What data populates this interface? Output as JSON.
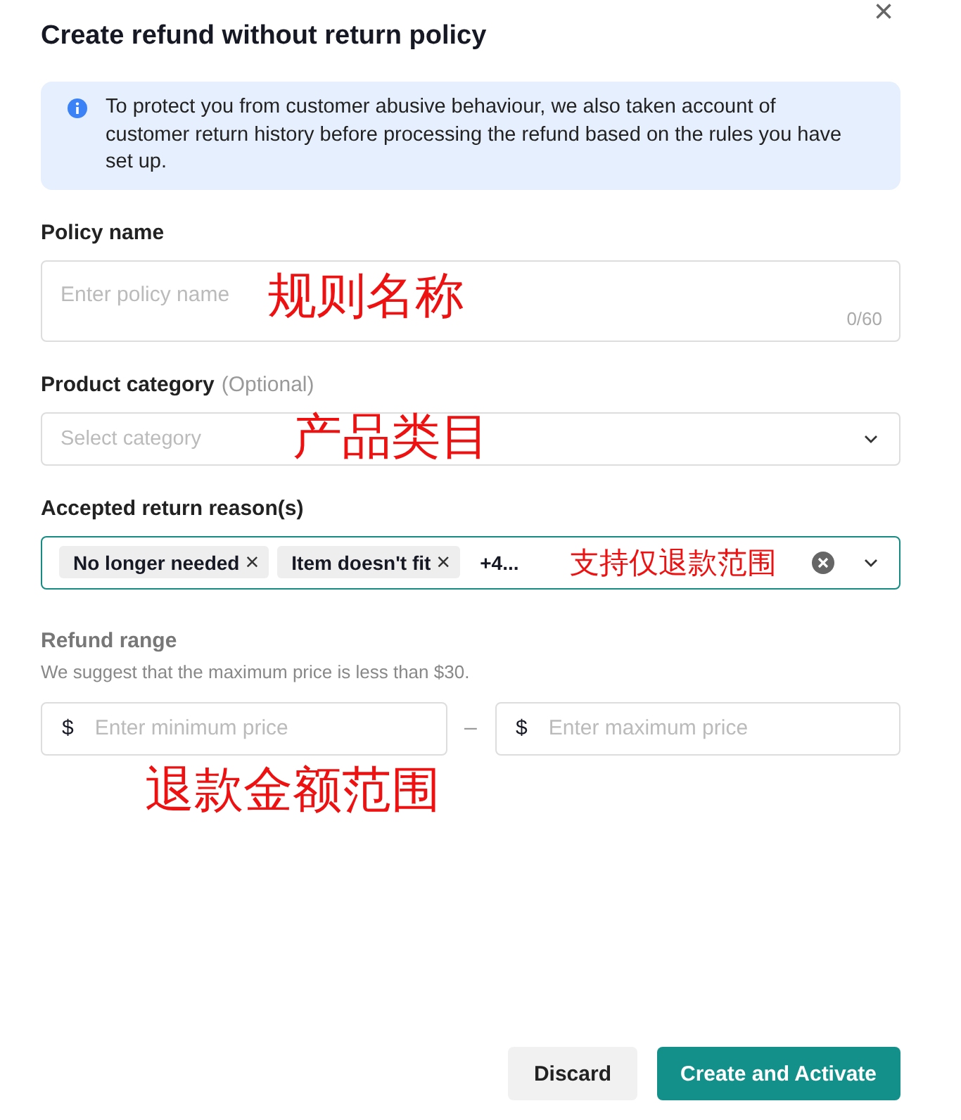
{
  "dialog": {
    "title": "Create refund without return policy",
    "close": "×"
  },
  "notice": {
    "text": "To protect you from customer abusive behaviour, we also taken account of customer return history before processing the refund based on the rules you have set up."
  },
  "policy_name": {
    "label": "Policy name",
    "placeholder": "Enter policy name",
    "counter": "0/60",
    "annotation": "规则名称"
  },
  "product_category": {
    "label": "Product category",
    "optional": "(Optional)",
    "placeholder": "Select category",
    "annotation": "产品类目"
  },
  "return_reasons": {
    "label": "Accepted return reason(s)",
    "tags": [
      {
        "label": "No longer needed",
        "remove": "×"
      },
      {
        "label": "Item doesn't fit",
        "remove": "×"
      }
    ],
    "more": "+4...",
    "annotation": "支持仅退款范围"
  },
  "refund_range": {
    "label": "Refund range",
    "hint": "We suggest that the maximum price is less than $30.",
    "currency": "$",
    "min_placeholder": "Enter minimum price",
    "separator": "–",
    "max_placeholder": "Enter maximum price",
    "annotation": "退款金额范围"
  },
  "buttons": [
    {
      "label": "Discard",
      "kind": "secondary"
    },
    {
      "label": "Create and Activate",
      "kind": "primary"
    }
  ]
}
